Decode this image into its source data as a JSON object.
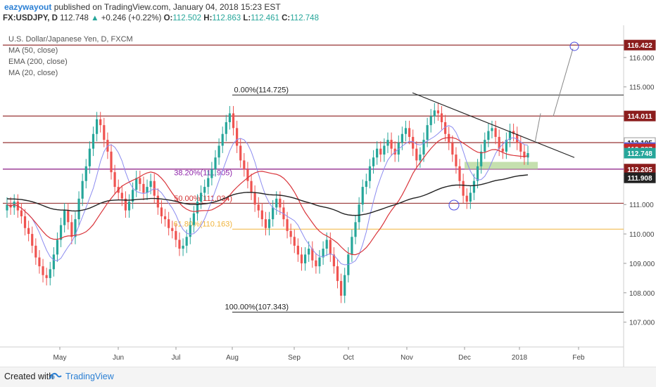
{
  "header": {
    "author": "eazywayout",
    "published": "published on TradingView.com, January 04, 2018 15:23 EST",
    "symbol": "FX:USDJPY, D",
    "last": "112.748",
    "change": "+0.246 (+0.22%)",
    "o_label": "O:",
    "o": "112.502",
    "h_label": "H:",
    "h": "112.863",
    "l_label": "L:",
    "l": "112.461",
    "c_label": "C:",
    "c": "112.748"
  },
  "legend": {
    "title": "U.S. Dollar/Japanese Yen, D, FXCM",
    "ma50": "MA (50, close)",
    "ema200": "EMA (200, close)",
    "ma20": "MA (20, close)"
  },
  "footer": {
    "created": "Created with",
    "brand": "TradingView"
  },
  "colors": {
    "up_candle": "#26a69a",
    "down_candle": "#ef5350",
    "ma50": "#d9343a",
    "ema200": "#222222",
    "ma20": "#8c8cf0",
    "resistance": "#8b1d1d",
    "fib_38": "#8e24aa",
    "fib_50": "#d32f2f",
    "fib_61": "#f0b43c",
    "zone": "#b7d89a"
  },
  "chart_data": {
    "type": "candlestick",
    "y_range": [
      106.3,
      117.0
    ],
    "y_ticks": [
      "116.000",
      "115.000",
      "114.000",
      "113.000",
      "112.000",
      "111.000",
      "110.000",
      "109.000",
      "108.000",
      "107.000"
    ],
    "x_labels": [
      "May",
      "Jun",
      "Jul",
      "Aug",
      "Sep",
      "Oct",
      "Nov",
      "Dec",
      "2018",
      "Feb"
    ],
    "price_tags": [
      {
        "value": 116.422,
        "label": "116.422",
        "color": "#8b1d1d"
      },
      {
        "value": 114.011,
        "label": "114.011",
        "color": "#8b1d1d"
      },
      {
        "value": 113.105,
        "label": "113.105",
        "color": "#ffffff",
        "text": "#222"
      },
      {
        "value": 112.934,
        "label": "112.934",
        "color": "#5b5bd6"
      },
      {
        "value": 112.887,
        "label": "112.887",
        "color": "#c62828"
      },
      {
        "value": 112.748,
        "label": "112.748",
        "color": "#26a69a"
      },
      {
        "value": 112.205,
        "label": "112.205",
        "color": "#8b1d1d"
      },
      {
        "value": 111.908,
        "label": "111.908",
        "color": "#222222"
      }
    ],
    "horizontal_levels": [
      116.422,
      114.011,
      113.105,
      112.205,
      111.044
    ],
    "fib_levels": [
      {
        "label": "0.00%(114.725)",
        "value": 114.725
      },
      {
        "label": "38.20%(111.905)",
        "value": 111.905
      },
      {
        "label": "50.00%(111.034)",
        "value": 111.034
      },
      {
        "label": "61.80%(110.163)",
        "value": 110.163
      },
      {
        "label": "100.00%(107.343)",
        "value": 107.343
      }
    ],
    "closes": [
      111.0,
      110.9,
      111.1,
      110.8,
      110.6,
      110.2,
      110.0,
      109.6,
      109.2,
      108.9,
      108.6,
      108.5,
      108.8,
      109.3,
      109.8,
      110.3,
      110.8,
      110.4,
      109.9,
      110.5,
      111.2,
      111.8,
      112.3,
      112.9,
      113.4,
      113.9,
      113.7,
      113.2,
      112.8,
      112.1,
      111.6,
      111.4,
      111.2,
      110.8,
      111.1,
      111.5,
      111.9,
      111.7,
      111.4,
      111.6,
      111.8,
      111.3,
      110.9,
      110.6,
      110.5,
      110.2,
      110.1,
      109.8,
      109.5,
      109.6,
      109.9,
      110.3,
      110.7,
      111.1,
      111.4,
      111.6,
      111.9,
      112.2,
      112.6,
      113.0,
      113.4,
      113.8,
      114.1,
      113.6,
      113.0,
      112.5,
      112.2,
      111.8,
      111.4,
      111.0,
      110.8,
      110.5,
      110.2,
      110.5,
      110.9,
      111.2,
      110.9,
      110.5,
      110.1,
      109.9,
      109.6,
      109.3,
      109.0,
      109.3,
      109.5,
      109.1,
      108.9,
      109.2,
      109.5,
      109.8,
      109.3,
      108.9,
      108.4,
      107.9,
      108.6,
      109.3,
      109.9,
      110.4,
      111.0,
      111.6,
      111.8,
      112.3,
      112.6,
      112.9,
      112.7,
      113.0,
      113.2,
      112.9,
      112.7,
      113.1,
      113.4,
      113.6,
      113.3,
      112.9,
      112.5,
      112.7,
      113.2,
      113.7,
      114.0,
      114.2,
      114.1,
      113.8,
      113.4,
      113.1,
      112.7,
      112.3,
      111.8,
      111.3,
      111.1,
      111.4,
      111.8,
      112.3,
      112.8,
      113.2,
      113.5,
      113.6,
      113.3,
      112.9,
      112.8,
      113.2,
      113.5,
      113.4,
      113.1,
      112.8,
      112.6,
      112.748
    ]
  }
}
